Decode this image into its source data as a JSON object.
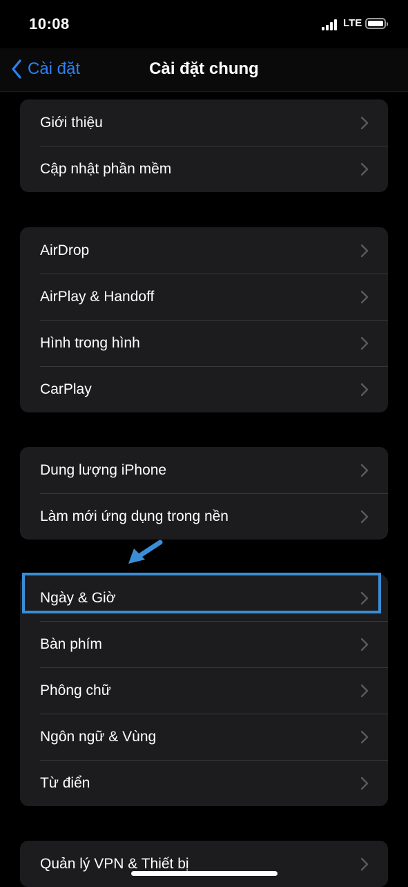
{
  "status": {
    "time": "10:08",
    "network": "LTE"
  },
  "nav": {
    "back_label": "Cài đặt",
    "title": "Cài đặt chung"
  },
  "groups": [
    {
      "rows": [
        {
          "label": "Giới thiệu"
        },
        {
          "label": "Cập nhật phần mềm"
        }
      ]
    },
    {
      "rows": [
        {
          "label": "AirDrop"
        },
        {
          "label": "AirPlay & Handoff"
        },
        {
          "label": "Hình trong hình"
        },
        {
          "label": "CarPlay"
        }
      ]
    },
    {
      "rows": [
        {
          "label": "Dung lượng iPhone"
        },
        {
          "label": "Làm mới ứng dụng trong nền"
        }
      ]
    },
    {
      "rows": [
        {
          "label": "Ngày & Giờ"
        },
        {
          "label": "Bàn phím"
        },
        {
          "label": "Phông chữ"
        },
        {
          "label": "Ngôn ngữ & Vùng"
        },
        {
          "label": "Từ điển"
        }
      ]
    },
    {
      "rows": [
        {
          "label": "Quản lý VPN & Thiết bị"
        }
      ]
    }
  ],
  "colors": {
    "accent": "#2b82f5",
    "highlight": "#3a8ed6",
    "group_bg": "#1c1c1e",
    "separator": "#38383a",
    "chevron": "#5a5a5e"
  },
  "icons": {
    "back": "chevron-left-icon",
    "row": "chevron-right-icon",
    "annotation": "arrow-annotation-icon"
  }
}
